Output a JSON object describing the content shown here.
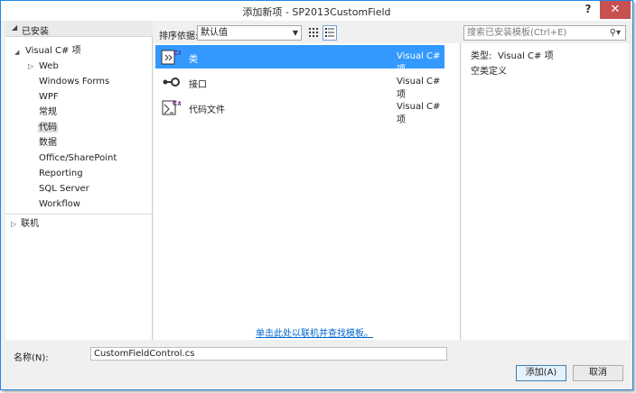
{
  "window": {
    "title": "添加新项 - SP2013CustomField",
    "help": "?",
    "close": "✕"
  },
  "tree": {
    "installed": "已安装",
    "root": "Visual C# 项",
    "items": [
      "Web",
      "Windows Forms",
      "WPF",
      "常规",
      "代码",
      "数据",
      "Office/SharePoint",
      "Reporting",
      "SQL Server",
      "Workflow"
    ],
    "selected": "代码",
    "online": "联机"
  },
  "toolbar": {
    "sort_label": "排序依据:",
    "sort_value": "默认值",
    "search_placeholder": "搜索已安装模板(Ctrl+E)"
  },
  "templates": [
    {
      "name": "类",
      "lang": "Visual C# 项",
      "icon": "class-icon",
      "selected": true
    },
    {
      "name": "接口",
      "lang": "Visual C# 项",
      "icon": "interface-icon",
      "selected": false
    },
    {
      "name": "代码文件",
      "lang": "Visual C# 项",
      "icon": "code-file-icon",
      "selected": false
    }
  ],
  "online_link": "单击此处以联机并查找模板。",
  "details": {
    "type_label": "类型:",
    "type_value": "Visual C# 项",
    "description": "空类定义"
  },
  "name_field": {
    "label": "名称(N):",
    "value": "CustomFieldControl.cs"
  },
  "buttons": {
    "add": "添加(A)",
    "cancel": "取消"
  },
  "colors": {
    "selection": "#3399ff",
    "close": "#c75050",
    "link": "#0066cc",
    "border": "#1e88e5"
  }
}
